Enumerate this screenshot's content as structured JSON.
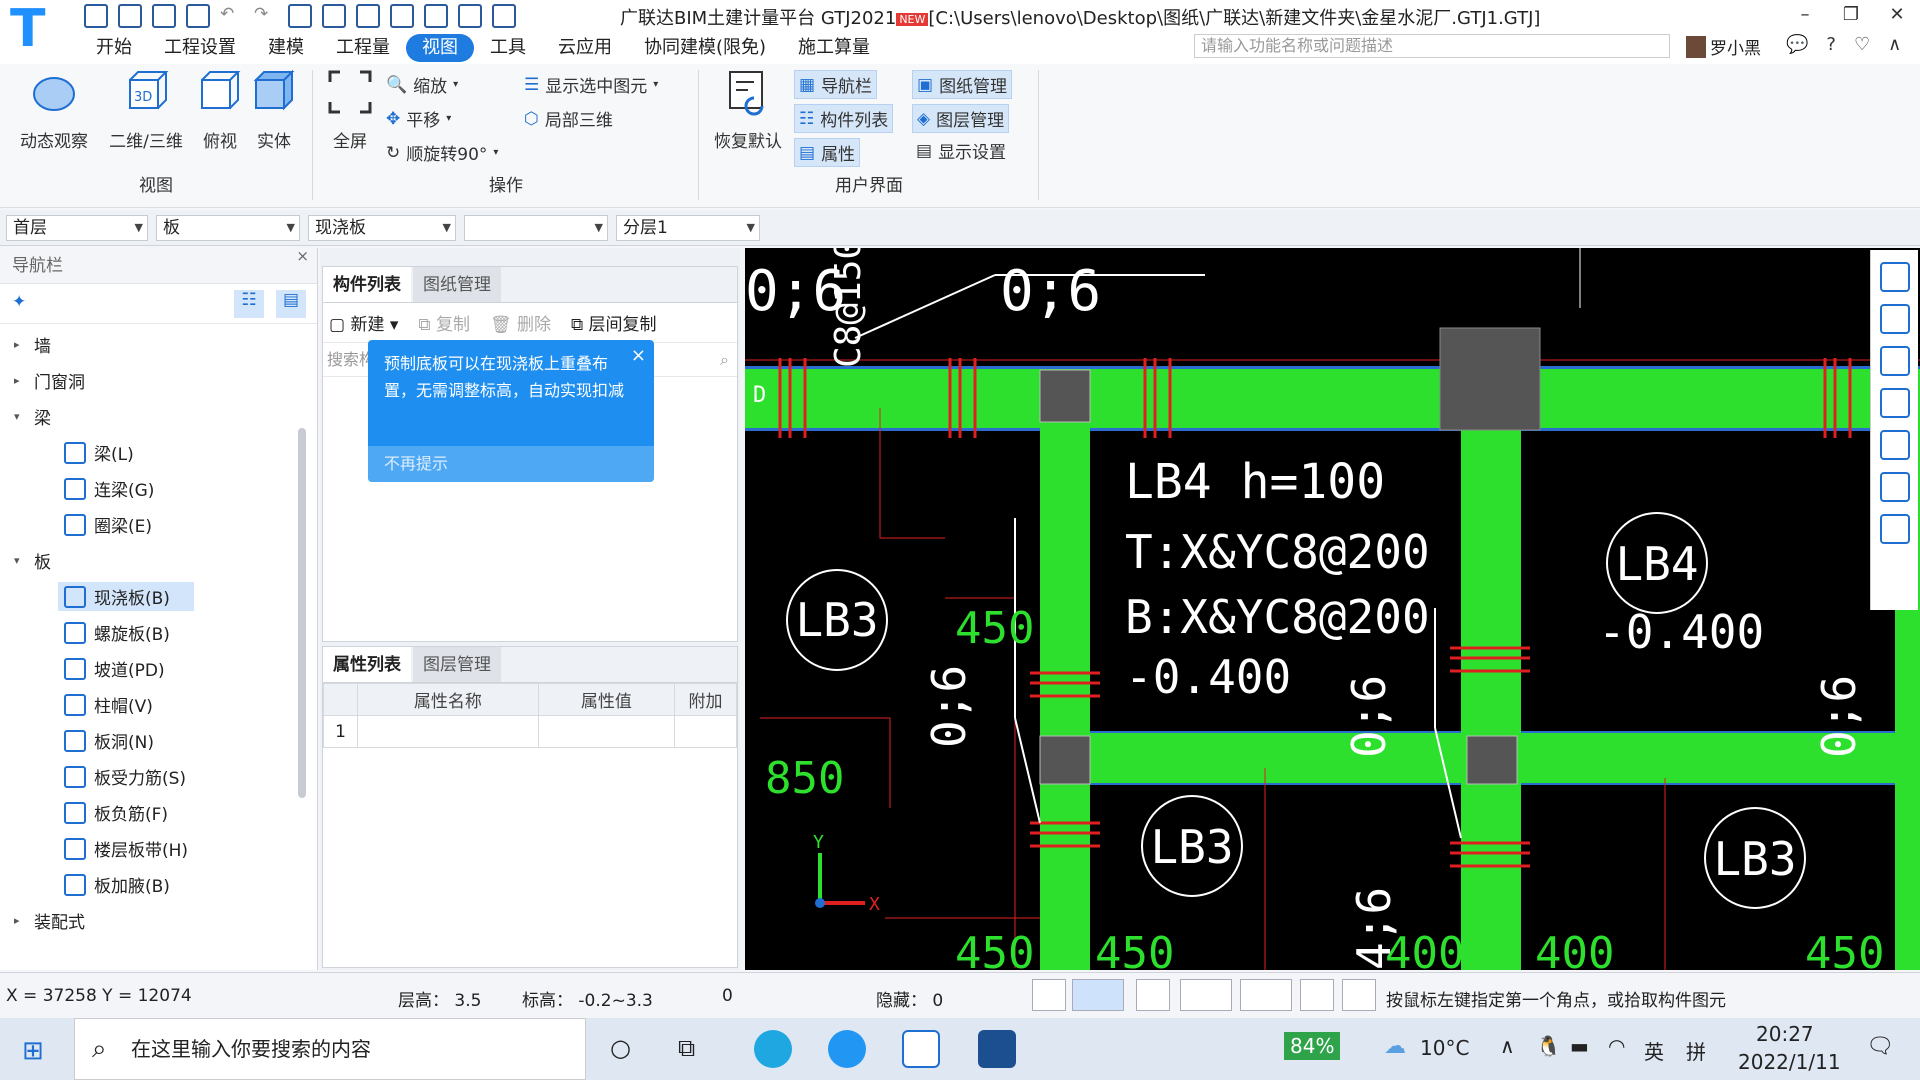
{
  "title_bar": {
    "title": "广联达BIM土建计量平台 GTJ2021",
    "badge": "NEW",
    "file_path": "[C:\\Users\\lenovo\\Desktop\\图纸\\广联达\\新建文件夹\\金星水泥厂.GTJ1.GTJ]",
    "min_label": "–",
    "restore_label": "❐",
    "close_label": "✕"
  },
  "menu": [
    "开始",
    "工程设置",
    "建模",
    "工程量",
    "视图",
    "工具",
    "云应用",
    "协同建模(限免)",
    "施工算量"
  ],
  "search_placeholder": "请输入功能名称或问题描述",
  "user_name": "罗小黑",
  "ribbon": {
    "view_group": "视图",
    "dynamic": "动态观察",
    "two_three": "二维/三维",
    "top_view": "俯视",
    "solid": "实体",
    "full_screen": "全屏",
    "zoom": "缩放",
    "pan": "平移",
    "rotate": "顺旋转90°",
    "show_selected": "显示选中图元",
    "local_3d": "局部三维",
    "ops_group": "操作",
    "restore_default": "恢复默认",
    "nav_bar": "导航栏",
    "component_list": "构件列表",
    "properties": "属性",
    "drawing_mgmt": "图纸管理",
    "layer_mgmt": "图层管理",
    "display_settings": "显示设置",
    "ui_group": "用户界面"
  },
  "filters": [
    "首层",
    "板",
    "现浇板",
    "",
    "分层1"
  ],
  "nav": {
    "header": "导航栏",
    "close": "×",
    "items": [
      {
        "label": "墙",
        "kind": "group",
        "collapsed": true
      },
      {
        "label": "门窗洞",
        "kind": "group",
        "collapsed": true
      },
      {
        "label": "梁",
        "kind": "group",
        "collapsed": false
      },
      {
        "label": "梁(L)",
        "kind": "leaf"
      },
      {
        "label": "连梁(G)",
        "kind": "leaf"
      },
      {
        "label": "圈梁(E)",
        "kind": "leaf"
      },
      {
        "label": "板",
        "kind": "group",
        "collapsed": false
      },
      {
        "label": "现浇板(B)",
        "kind": "leaf",
        "selected": true
      },
      {
        "label": "螺旋板(B)",
        "kind": "leaf"
      },
      {
        "label": "坡道(PD)",
        "kind": "leaf"
      },
      {
        "label": "柱帽(V)",
        "kind": "leaf"
      },
      {
        "label": "板洞(N)",
        "kind": "leaf"
      },
      {
        "label": "板受力筋(S)",
        "kind": "leaf"
      },
      {
        "label": "板负筋(F)",
        "kind": "leaf"
      },
      {
        "label": "楼层板带(H)",
        "kind": "leaf"
      },
      {
        "label": "板加腋(B)",
        "kind": "leaf"
      },
      {
        "label": "装配式",
        "kind": "group",
        "collapsed": true
      }
    ]
  },
  "component_panel": {
    "tab_list": "构件列表",
    "tab_drawing": "图纸管理",
    "new": "新建",
    "copy": "复制",
    "delete": "删除",
    "floor_copy": "层间复制",
    "search": "搜索构",
    "tip_text": "预制底板可以在现浇板上重叠布置，无需调整标高，自动实现扣减",
    "tip_dismiss": "不再提示",
    "tip_close": "×"
  },
  "property_panel": {
    "tab_props": "属性列表",
    "tab_layers": "图层管理",
    "col_name": "属性名称",
    "col_value": "属性值",
    "col_extra": "附加",
    "row_index": "1"
  },
  "cad": {
    "labels": [
      "0;6",
      "LB4 h=100",
      "T:X&YC8@200",
      "B:X&YC8@200",
      "-0.400",
      "LB3",
      "LB4",
      "-0.400",
      "LB3",
      "LB3",
      "450",
      "850",
      "450",
      "450",
      "400",
      "400",
      "450",
      "C8@150",
      "0;6",
      "0;6",
      "0;6",
      "4;6",
      "D",
      "Y",
      "X"
    ],
    "green": "#2ee02e",
    "red": "#e02020"
  },
  "status": {
    "coords": "X = 37258 Y = 12074",
    "floor_height": "层高：  3.5",
    "elevation": "标高：  -0.2~3.3",
    "zero": "0",
    "hidden": "隐藏：  0",
    "hint": "按鼠标左键指定第一个角点，或拾取构件图元"
  },
  "taskbar": {
    "search": "在这里输入你要搜索的内容",
    "battery": "84%",
    "temp": "10°C",
    "lang": "英",
    "ime": "拼",
    "time": "20:27",
    "date": "2022/1/11"
  }
}
